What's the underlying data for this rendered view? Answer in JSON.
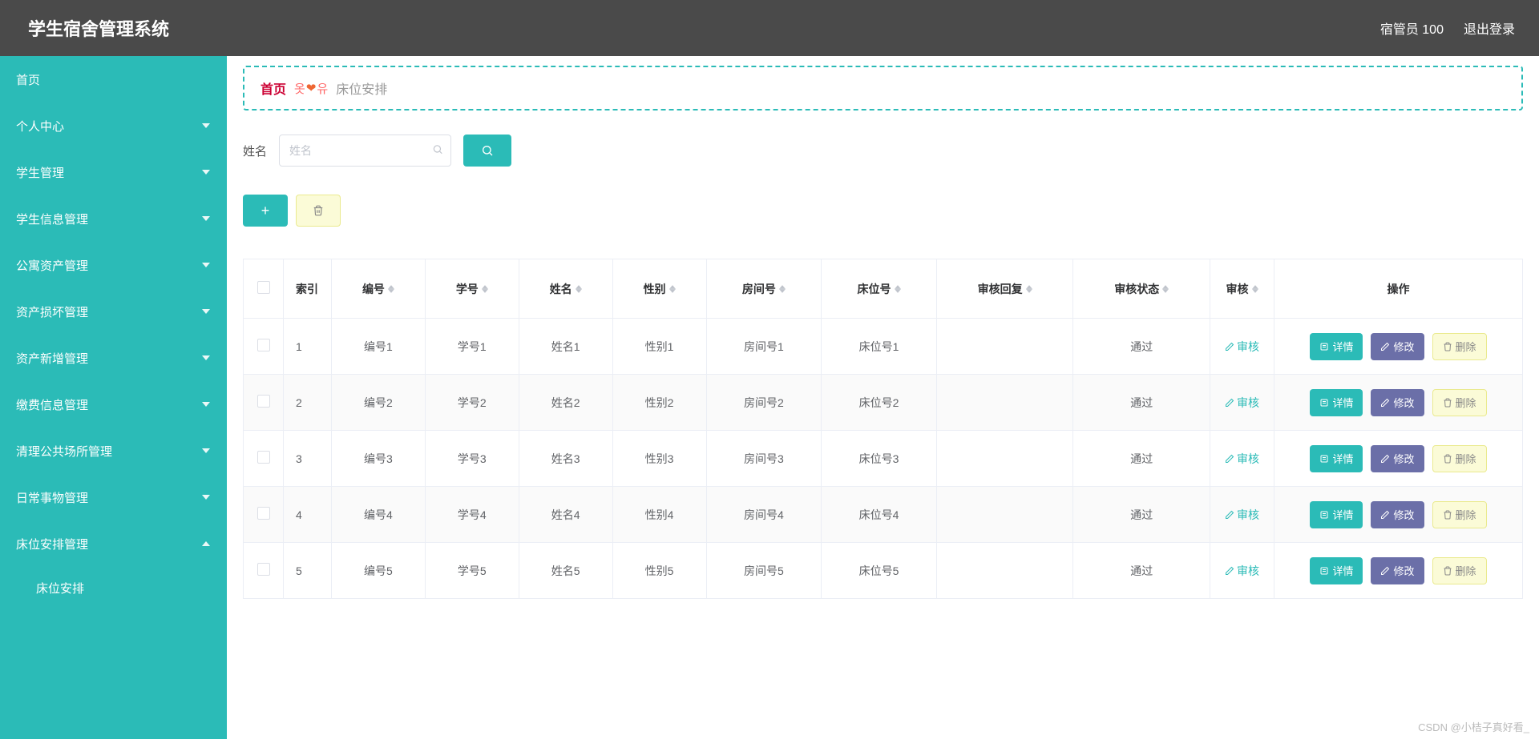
{
  "header": {
    "title": "学生宿舍管理系统",
    "user": "宿管员 100",
    "logout": "退出登录"
  },
  "sidebar": {
    "items": [
      {
        "label": "首页",
        "expandable": false
      },
      {
        "label": "个人中心",
        "expandable": true,
        "open": false
      },
      {
        "label": "学生管理",
        "expandable": true,
        "open": false
      },
      {
        "label": "学生信息管理",
        "expandable": true,
        "open": false
      },
      {
        "label": "公寓资产管理",
        "expandable": true,
        "open": false
      },
      {
        "label": "资产损坏管理",
        "expandable": true,
        "open": false
      },
      {
        "label": "资产新增管理",
        "expandable": true,
        "open": false
      },
      {
        "label": "缴费信息管理",
        "expandable": true,
        "open": false
      },
      {
        "label": "清理公共场所管理",
        "expandable": true,
        "open": false
      },
      {
        "label": "日常事物管理",
        "expandable": true,
        "open": false
      },
      {
        "label": "床位安排管理",
        "expandable": true,
        "open": true,
        "children": [
          {
            "label": "床位安排"
          }
        ]
      }
    ]
  },
  "breadcrumb": {
    "home": "首页",
    "current": "床位安排"
  },
  "search": {
    "label": "姓名",
    "placeholder": "姓名"
  },
  "table": {
    "headers": {
      "index": "索引",
      "bianhao": "编号",
      "xuehao": "学号",
      "xingming": "姓名",
      "xingbie": "性别",
      "fangjian": "房间号",
      "chuangwei": "床位号",
      "huifu": "审核回复",
      "zhuangtai": "审核状态",
      "shenhe": "审核",
      "caozuo": "操作"
    },
    "audit_label": "审核",
    "ops": {
      "detail": "详情",
      "edit": "修改",
      "delete": "删除"
    },
    "rows": [
      {
        "idx": "1",
        "bianhao": "编号1",
        "xuehao": "学号1",
        "xingming": "姓名1",
        "xingbie": "性别1",
        "fangjian": "房间号1",
        "chuangwei": "床位号1",
        "huifu": "",
        "zhuangtai": "通过"
      },
      {
        "idx": "2",
        "bianhao": "编号2",
        "xuehao": "学号2",
        "xingming": "姓名2",
        "xingbie": "性别2",
        "fangjian": "房间号2",
        "chuangwei": "床位号2",
        "huifu": "",
        "zhuangtai": "通过"
      },
      {
        "idx": "3",
        "bianhao": "编号3",
        "xuehao": "学号3",
        "xingming": "姓名3",
        "xingbie": "性别3",
        "fangjian": "房间号3",
        "chuangwei": "床位号3",
        "huifu": "",
        "zhuangtai": "通过"
      },
      {
        "idx": "4",
        "bianhao": "编号4",
        "xuehao": "学号4",
        "xingming": "姓名4",
        "xingbie": "性别4",
        "fangjian": "房间号4",
        "chuangwei": "床位号4",
        "huifu": "",
        "zhuangtai": "通过"
      },
      {
        "idx": "5",
        "bianhao": "编号5",
        "xuehao": "学号5",
        "xingming": "姓名5",
        "xingbie": "性别5",
        "fangjian": "房间号5",
        "chuangwei": "床位号5",
        "huifu": "",
        "zhuangtai": "通过"
      }
    ]
  },
  "watermark": "CSDN @小桔子真好看_"
}
